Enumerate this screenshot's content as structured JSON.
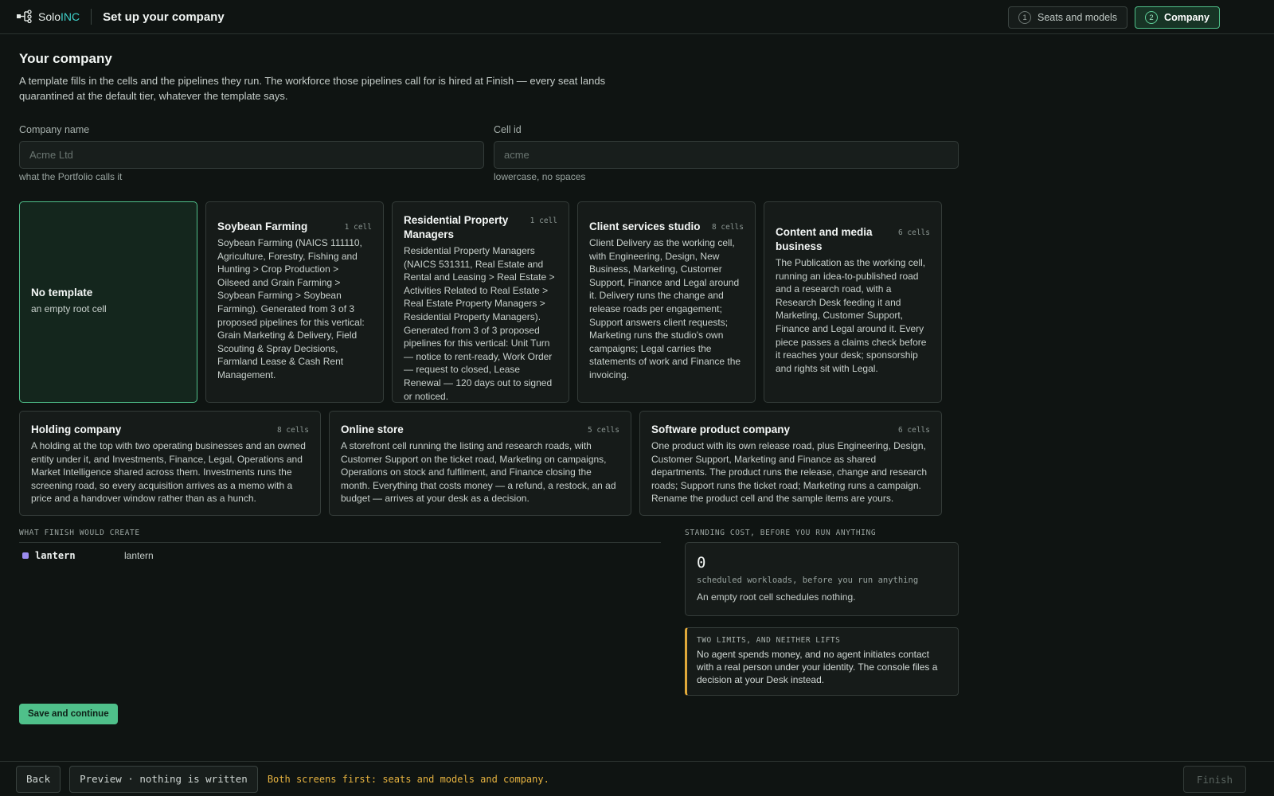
{
  "header": {
    "brand_prefix": "Solo",
    "brand_suffix": "INC",
    "title": "Set up your company",
    "steps": [
      {
        "num": "1",
        "label": "Seats and models"
      },
      {
        "num": "2",
        "label": "Company"
      }
    ]
  },
  "company": {
    "title": "Your company",
    "intro": "A template fills in the cells and the pipelines they run. The workforce those pipelines call for is hired at Finish — every seat lands quarantined at the default tier, whatever the template says.",
    "name_field": {
      "label": "Company name",
      "placeholder": "Acme Ltd",
      "value": "",
      "hint": "what the Portfolio calls it"
    },
    "cell_field": {
      "label": "Cell id",
      "placeholder": "acme",
      "value": "",
      "hint": "lowercase, no spaces"
    }
  },
  "templates": [
    {
      "title": "No template",
      "count": "",
      "desc": "an empty root cell"
    },
    {
      "title": "Soybean Farming",
      "count": "1 cell",
      "desc": "Soybean Farming (NAICS 111110, Agriculture, Forestry, Fishing and Hunting > Crop Production > Oilseed and Grain Farming > Soybean Farming > Soybean Farming). Generated from 3 of 3 proposed pipelines for this vertical: Grain Marketing & Delivery, Field Scouting & Spray Decisions, Farmland Lease & Cash Rent Management."
    },
    {
      "title": "Residential Property Managers",
      "count": "1 cell",
      "desc": "Residential Property Managers (NAICS 531311, Real Estate and Rental and Leasing > Real Estate > Activities Related to Real Estate > Real Estate Property Managers > Residential Property Managers). Generated from 3 of 3 proposed pipelines for this vertical: Unit Turn — notice to rent-ready, Work Order — request to closed, Lease Renewal — 120 days out to signed or noticed."
    },
    {
      "title": "Client services studio",
      "count": "8 cells",
      "desc": "Client Delivery as the working cell, with Engineering, Design, New Business, Marketing, Customer Support, Finance and Legal around it. Delivery runs the change and release roads per engagement; Support answers client requests; Marketing runs the studio's own campaigns; Legal carries the statements of work and Finance the invoicing."
    },
    {
      "title": "Content and media business",
      "count": "6 cells",
      "desc": "The Publication as the working cell, running an idea-to-published road and a research road, with a Research Desk feeding it and Marketing, Customer Support, Finance and Legal around it. Every piece passes a claims check before it reaches your desk; sponsorship and rights sit with Legal."
    },
    {
      "title": "Holding company",
      "count": "8 cells",
      "desc": "A holding at the top with two operating businesses and an owned entity under it, and Investments, Finance, Legal, Operations and Market Intelligence shared across them. Investments runs the screening road, so every acquisition arrives as a memo with a price and a handover window rather than as a hunch."
    },
    {
      "title": "Online store",
      "count": "5 cells",
      "desc": "A storefront cell running the listing and research roads, with Customer Support on the ticket road, Marketing on campaigns, Operations on stock and fulfilment, and Finance closing the month. Everything that costs money — a refund, a restock, an ad budget — arrives at your desk as a decision."
    },
    {
      "title": "Software product company",
      "count": "6 cells",
      "desc": "One product with its own release road, plus Engineering, Design, Customer Support, Marketing and Finance as shared departments. The product runs the release, change and research roads; Support runs the ticket road; Marketing runs a campaign. Rename the product cell and the sample items are yours."
    }
  ],
  "create": {
    "label": "WHAT FINISH WOULD CREATE",
    "items": [
      {
        "id": "lantern",
        "name": "lantern",
        "color": "#9b8cf0"
      }
    ]
  },
  "cost": {
    "label": "STANDING COST, BEFORE YOU RUN ANYTHING",
    "value": "0",
    "caption": "scheduled workloads, before you run anything",
    "note": "An empty root cell schedules nothing."
  },
  "limits": {
    "title": "TWO LIMITS, AND NEITHER LIFTS",
    "text": "No agent spends money, and no agent initiates contact with a real person under your identity. The console files a decision at your Desk instead."
  },
  "actions": {
    "save": "Save and continue"
  },
  "footer": {
    "back": "Back",
    "preview": "Preview · nothing is written",
    "warning": "Both screens first: seats and models and company.",
    "finish": "Finish"
  },
  "colors": {
    "accent": "#4fc08a",
    "brand_accent": "#3fd0c9",
    "warning": "#e7b340",
    "background": "#0f1412"
  }
}
